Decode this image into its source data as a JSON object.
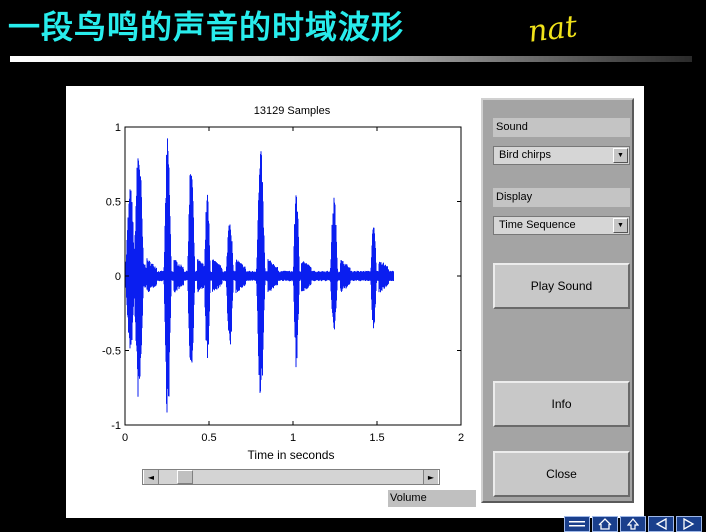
{
  "slide": {
    "title": "一段鸟鸣的声音的时域波形",
    "handwriting": "nat"
  },
  "plot": {
    "title": "13129 Samples",
    "xlabel": "Time in seconds",
    "wave_color": "#0a1ef0"
  },
  "chart_data": {
    "type": "line",
    "title": "13129 Samples",
    "xlabel": "Time in seconds",
    "ylabel": "",
    "xlim": [
      0,
      2
    ],
    "ylim": [
      -1,
      1
    ],
    "xticks": [
      0,
      0.5,
      1,
      1.5,
      2
    ],
    "xtick_labels": [
      "0",
      "0.5",
      "1",
      "1.5",
      "2"
    ],
    "yticks": [
      1,
      0.5,
      0,
      -0.5,
      -1
    ],
    "ytick_labels": [
      "1",
      "0.5",
      "0",
      "-0.5",
      "-1"
    ],
    "grid": false,
    "series": [
      {
        "samples": 13129,
        "duration": 1.6,
        "bursts": [
          {
            "start": 0.0,
            "end": 0.08,
            "max": 0.6,
            "min": -0.52
          },
          {
            "start": 0.05,
            "end": 0.13,
            "max": 0.91,
            "min": -0.86
          },
          {
            "start": 0.23,
            "end": 0.29,
            "max": 0.95,
            "min": -1.0
          },
          {
            "start": 0.37,
            "end": 0.43,
            "max": 0.8,
            "min": -0.68
          },
          {
            "start": 0.47,
            "end": 0.52,
            "max": 0.58,
            "min": -0.63
          },
          {
            "start": 0.6,
            "end": 0.66,
            "max": 0.43,
            "min": -0.54
          },
          {
            "start": 0.78,
            "end": 0.85,
            "max": 0.85,
            "min": -0.89
          },
          {
            "start": 1.0,
            "end": 1.05,
            "max": 0.64,
            "min": -0.66
          },
          {
            "start": 1.22,
            "end": 1.28,
            "max": 0.56,
            "min": -0.39
          },
          {
            "start": 1.46,
            "end": 1.51,
            "max": 0.36,
            "min": -0.38
          }
        ]
      }
    ]
  },
  "scroll": {
    "left_arrow": "◄",
    "right_arrow": "►"
  },
  "volume": {
    "label": "Volume"
  },
  "panel": {
    "sound_label": "Sound",
    "sound_value": "Bird chirps",
    "display_label": "Display",
    "display_value": "Time Sequence",
    "dropdown_arrow": "▼",
    "play_button": "Play Sound",
    "info_button": "Info",
    "close_button": "Close"
  },
  "nav": {
    "icons": [
      "nav-menu-icon",
      "nav-home-icon",
      "nav-up-icon",
      "nav-prev-icon",
      "nav-next-icon"
    ]
  }
}
